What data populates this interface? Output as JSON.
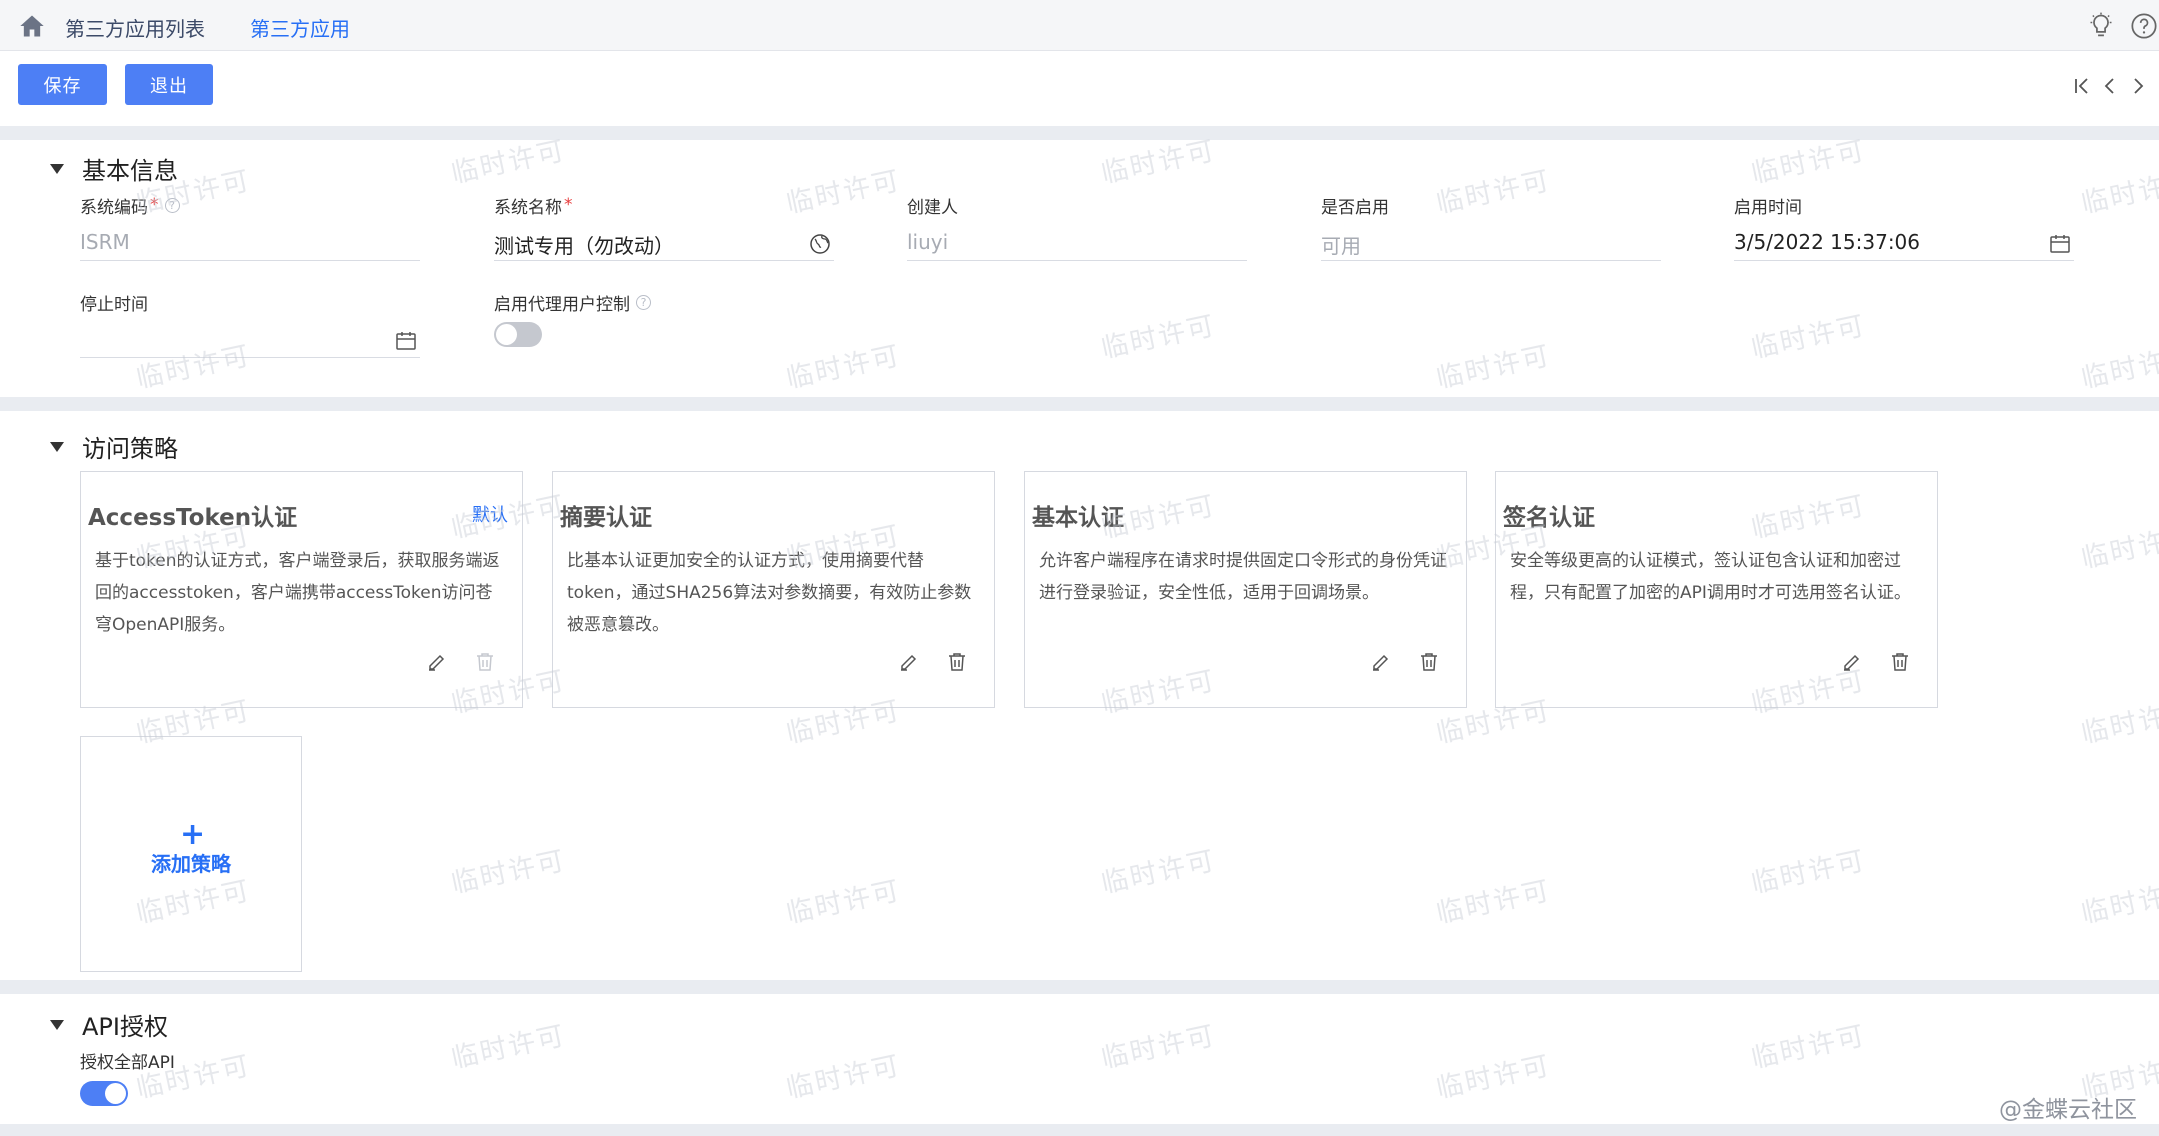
{
  "tabs": [
    {
      "label": "第三方应用列表"
    },
    {
      "label": "第三方应用"
    }
  ],
  "toolbar": {
    "save_label": "保存",
    "exit_label": "退出"
  },
  "basic_info": {
    "title": "基本信息",
    "fields": {
      "system_code": {
        "label": "系统编码",
        "value": "ISRM"
      },
      "system_name": {
        "label": "系统名称",
        "value": "测试专用（勿改动）"
      },
      "creator": {
        "label": "创建人",
        "value": "liuyi"
      },
      "enabled": {
        "label": "是否启用",
        "value": "可用"
      },
      "start_time": {
        "label": "启用时间",
        "value": "3/5/2022 15:37:06"
      },
      "stop_time": {
        "label": "停止时间",
        "value": ""
      },
      "proxy_user_control": {
        "label": "启用代理用户控制",
        "on": false
      }
    },
    "required_mark": "*",
    "help_mark": "?"
  },
  "access_policy": {
    "title": "访问策略",
    "cards": [
      {
        "title": "AccessToken认证",
        "badge": "默认",
        "desc": "基于token的认证方式，客户端登录后，获取服务端返回的accesstoken，客户端携带accessToken访问苍穹OpenAPI服务。"
      },
      {
        "title": "摘要认证",
        "badge": "",
        "desc": "比基本认证更加安全的认证方式，使用摘要代替token，通过SHA256算法对参数摘要，有效防止参数被恶意篡改。"
      },
      {
        "title": "基本认证",
        "badge": "",
        "desc": "允许客户端程序在请求时提供固定口令形式的身份凭证进行登录验证，安全性低，适用于回调场景。"
      },
      {
        "title": "签名认证",
        "badge": "",
        "desc": "安全等级更高的认证模式，签认证包含认证和加密过程，只有配置了加密的API调用时才可选用签名认证。"
      }
    ],
    "add_label": "添加策略",
    "add_plus": "+"
  },
  "api_auth": {
    "title": "API授权",
    "authorize_all": {
      "label": "授权全部API",
      "on": true
    }
  },
  "watermark_text": "临时许可",
  "corner_mark": "@金蝶云社区",
  "colors": {
    "accent": "#276ff5",
    "button": "#4d7ff5",
    "required": "#e63b3b",
    "section_gap": "#e9ecf1"
  }
}
